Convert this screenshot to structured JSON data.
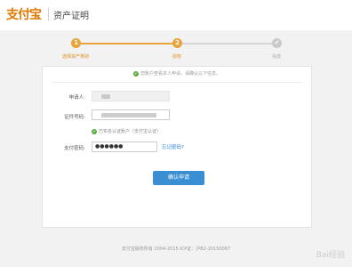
{
  "header": {
    "logo": "支付宝",
    "title": "资产证明"
  },
  "steps": [
    {
      "num": "1",
      "label": "选择资产类别",
      "state": "done"
    },
    {
      "num": "2",
      "label": "授权",
      "state": "current"
    },
    {
      "num": "✔",
      "label": "完成",
      "state": "todo"
    }
  ],
  "colors": {
    "active": "#e8a33b",
    "inactive": "#c9c9c9",
    "button": "#3a8fd3"
  },
  "notice": "您账户查看本人申请，请确认以下信息。",
  "form": {
    "applicant_label": "申请人:",
    "applicant_value": "",
    "id_label": "证件号码:",
    "id_value": "",
    "id_hint": "已实名认证账户（支付宝认证）",
    "password_label": "支付密码:",
    "password_value": "●●●●●●",
    "forgot_link": "忘记密码?"
  },
  "confirm_label": "确认申请",
  "footer": "支付宝版权所有 2004-2015 ICP证：沪B2-20150087",
  "watermark": "Bai经验"
}
